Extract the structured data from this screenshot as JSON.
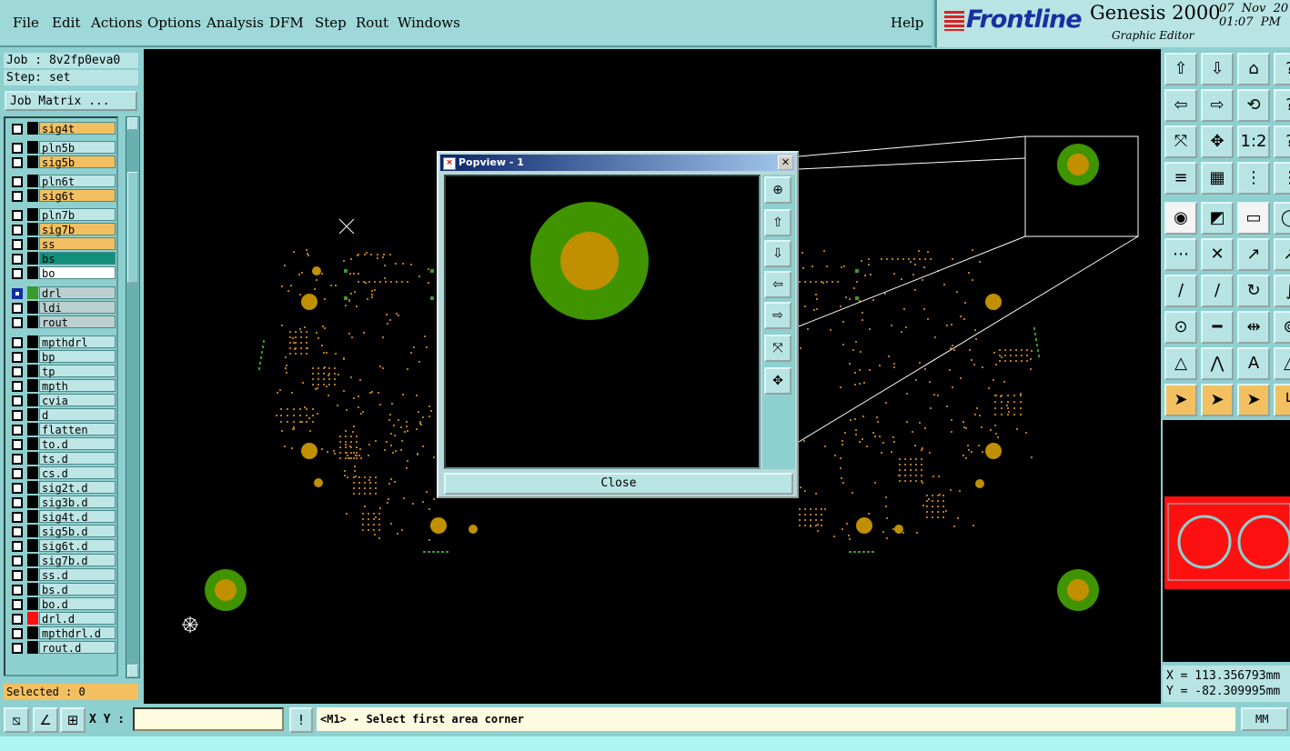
{
  "menubar": {
    "items": [
      {
        "label": "File"
      },
      {
        "label": "Edit"
      },
      {
        "label": "Actions"
      },
      {
        "label": "Options"
      },
      {
        "label": "Analysis"
      },
      {
        "label": "DFM"
      },
      {
        "label": "Step"
      },
      {
        "label": "Rout"
      },
      {
        "label": "Windows"
      }
    ],
    "help": "Help"
  },
  "brand": {
    "logo": "Frontline",
    "title": "Genesis 2000",
    "subtitle": "Graphic Editor",
    "date": "07  Nov  20",
    "time": "01:07  PM"
  },
  "left": {
    "job": "Job : 8v2fp0eva0",
    "step": "Step: set",
    "job_matrix": "Job Matrix ...",
    "selected": "Selected : 0",
    "layers": [
      {
        "name": "sig4t",
        "style": "o",
        "color": "#000000"
      },
      {
        "name": "pln5b",
        "style": "b",
        "color": "#000000"
      },
      {
        "name": "sig5b",
        "style": "o",
        "color": "#000000"
      },
      {
        "name": "pln6t",
        "style": "b",
        "color": "#000000"
      },
      {
        "name": "sig6t",
        "style": "o",
        "color": "#000000"
      },
      {
        "name": "pln7b",
        "style": "b",
        "color": "#000000"
      },
      {
        "name": "sig7b",
        "style": "o",
        "color": "#000000"
      },
      {
        "name": "ss",
        "style": "o",
        "color": "#000000"
      },
      {
        "name": "bs",
        "style": "t",
        "color": "#000000"
      },
      {
        "name": "bo",
        "style": "w",
        "color": "#000000"
      },
      {
        "name": "drl",
        "style": "g",
        "color": "#3a9a2a"
      },
      {
        "name": "ldi",
        "style": "g",
        "color": "#000000"
      },
      {
        "name": "rout",
        "style": "g",
        "color": "#000000"
      },
      {
        "name": "mpthdrl",
        "style": "b",
        "color": "#000000"
      },
      {
        "name": "bp",
        "style": "b",
        "color": "#000000"
      },
      {
        "name": "tp",
        "style": "b",
        "color": "#000000"
      },
      {
        "name": "mpth",
        "style": "b",
        "color": "#000000"
      },
      {
        "name": "cvia",
        "style": "b",
        "color": "#000000"
      },
      {
        "name": "d",
        "style": "b",
        "color": "#000000"
      },
      {
        "name": "flatten",
        "style": "b",
        "color": "#000000"
      },
      {
        "name": "to.d",
        "style": "b",
        "color": "#000000"
      },
      {
        "name": "ts.d",
        "style": "b",
        "color": "#000000"
      },
      {
        "name": "cs.d",
        "style": "b",
        "color": "#000000"
      },
      {
        "name": "sig2t.d",
        "style": "b",
        "color": "#000000"
      },
      {
        "name": "sig3b.d",
        "style": "b",
        "color": "#000000"
      },
      {
        "name": "sig4t.d",
        "style": "b",
        "color": "#000000"
      },
      {
        "name": "sig5b.d",
        "style": "b",
        "color": "#000000"
      },
      {
        "name": "sig6t.d",
        "style": "b",
        "color": "#000000"
      },
      {
        "name": "sig7b.d",
        "style": "b",
        "color": "#000000"
      },
      {
        "name": "ss.d",
        "style": "b",
        "color": "#000000"
      },
      {
        "name": "bs.d",
        "style": "b",
        "color": "#000000"
      },
      {
        "name": "bo.d",
        "style": "b",
        "color": "#000000"
      },
      {
        "name": "drl.d",
        "style": "b",
        "color": "#ff1010"
      },
      {
        "name": "mpthdrl.d",
        "style": "b",
        "color": "#000000"
      },
      {
        "name": "rout.d",
        "style": "b",
        "color": "#000000"
      }
    ]
  },
  "popview": {
    "title": "Popview - 1",
    "close_label": "Close"
  },
  "right": {
    "x": "X = 113.356793mm",
    "y": "Y = -82.309995mm"
  },
  "bottom": {
    "xy_label": "X Y :",
    "xy_value": "",
    "prompt": "<M1> - Select first area corner",
    "unit": "MM"
  },
  "colors": {
    "pad_outer": "#3f9400",
    "pad_inner": "#c09000",
    "canvas": "#000000"
  }
}
